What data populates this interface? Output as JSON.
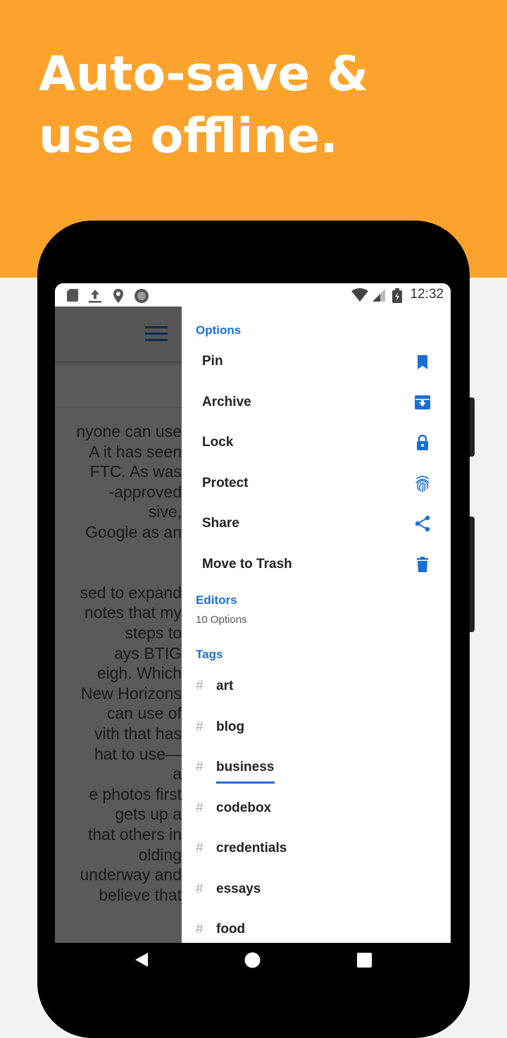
{
  "headline": {
    "line1": "Auto-save &",
    "line2": "use offline."
  },
  "status_bar": {
    "time": "12:32"
  },
  "note_fragments": [
    "nyone can use",
    "A it has seen",
    "FTC. As was",
    "-approved",
    "sive,",
    "Google as an",
    "",
    "",
    "sed to expand",
    "notes that my",
    "steps to",
    "ays BTIG",
    "eigh. Which",
    "New Horizons",
    "can use of",
    "vith that has",
    "hat to use—",
    "a",
    "e photos first",
    "gets up a",
    "that others in",
    "olding",
    "underway and",
    "believe that"
  ],
  "drawer": {
    "options_title": "Options",
    "options": [
      {
        "label": "Pin",
        "icon": "bookmark-icon"
      },
      {
        "label": "Archive",
        "icon": "archive-icon"
      },
      {
        "label": "Lock",
        "icon": "lock-icon"
      },
      {
        "label": "Protect",
        "icon": "fingerprint-icon"
      },
      {
        "label": "Share",
        "icon": "share-icon"
      },
      {
        "label": "Move to Trash",
        "icon": "trash-icon"
      }
    ],
    "editors_title": "Editors",
    "editors_sub": "10 Options",
    "tags_title": "Tags",
    "hash_symbol": "#",
    "tags": [
      "art",
      "blog",
      "business",
      "codebox",
      "credentials",
      "essays",
      "food"
    ],
    "selected_tag": "business"
  },
  "colors": {
    "brand_orange": "#fba32c",
    "accent_blue": "#1a6fd6"
  }
}
